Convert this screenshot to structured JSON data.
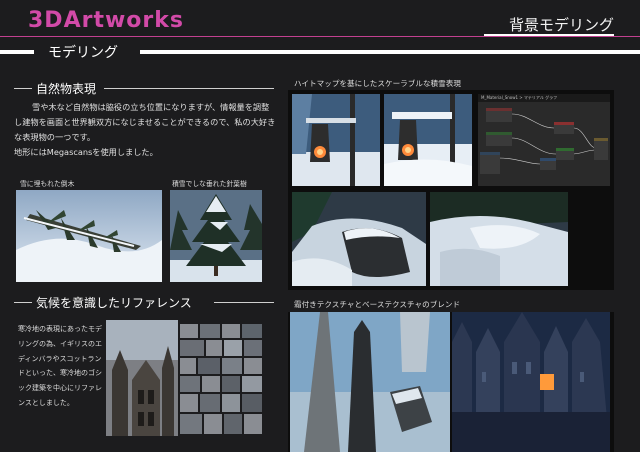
{
  "header": {
    "brand": "3DArtworks",
    "title": "背景モデリング"
  },
  "section": {
    "title": "モデリング"
  },
  "nature": {
    "heading": "自然物表現",
    "paragraphs": [
      "雪や木など自然物は脇役の立ち位置になりますが、情報量を調整し建物を画面と世界観双方になじませることができるので、私の大好きな表現物の一つです。",
      "地形にはMegascansを使用しました。"
    ],
    "caption_left": "雪に埋もれた倒木",
    "caption_right": "積雪でしな垂れた針葉樹"
  },
  "climate": {
    "heading": "気候を意識したリファレンス",
    "text": "寒冷地の表現にあったモデリングの為、イギリスのエディンバラやスコットランドといった、寒冷地のゴシック建築を中心にリファレンスとしました。"
  },
  "snow": {
    "caption": "ハイトマップを基にしたスケーラブルな積雪表現",
    "node_title": "M_Material_Snow1 > マテリアル グラフ"
  },
  "frost": {
    "caption": "霜付きテクスチャとベーステクスチャのブレンド"
  },
  "colors": {
    "accent": "#d24aa8",
    "background": "#1c1c1e",
    "panel": "#0d0d0d"
  }
}
